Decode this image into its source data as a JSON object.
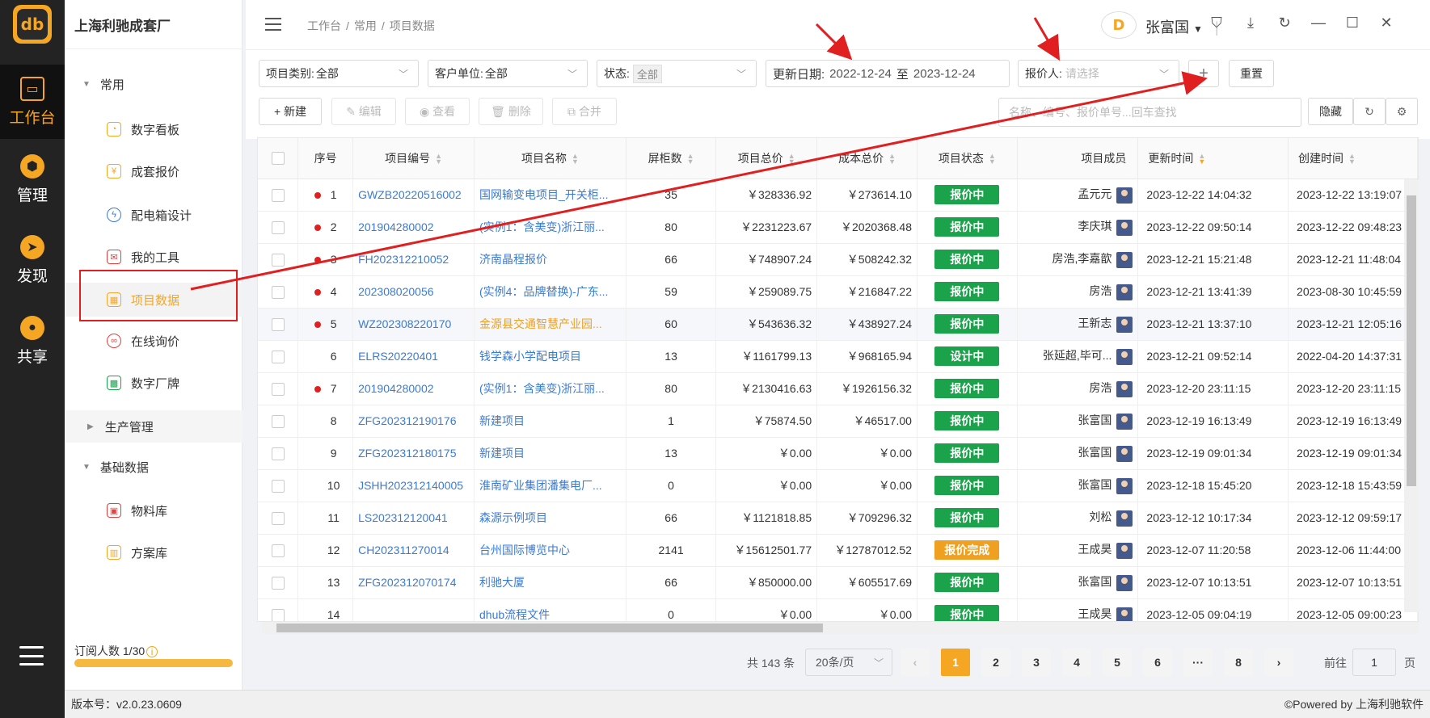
{
  "leftnav": {
    "logo": "db",
    "items": [
      {
        "label": "工作台",
        "icon": "monitor-icon",
        "active": true
      },
      {
        "label": "管理",
        "icon": "hexagon-icon"
      },
      {
        "label": "发现",
        "icon": "compass-icon"
      },
      {
        "label": "共享",
        "icon": "share-icon"
      }
    ]
  },
  "sidebar": {
    "company": "上海利驰成套厂",
    "groups": {
      "common": "常用",
      "production": "生产管理",
      "basic": "基础数据"
    },
    "items": [
      "数字看板",
      "成套报价",
      "配电箱设计",
      "我的工具",
      "项目数据",
      "在线询价",
      "数字厂牌",
      "物料库",
      "方案库"
    ],
    "subscribe": "订阅人数 1/30"
  },
  "header": {
    "breadcrumb": [
      "工作台",
      "/",
      "常用",
      "/",
      "项目数据"
    ],
    "user_logo": "D",
    "username": "张富国"
  },
  "filters": {
    "category_label": "项目类别:",
    "category_value": "全部",
    "customer_label": "客户单位:",
    "customer_value": "全部",
    "status_label": "状态:",
    "status_value": "全部",
    "date_label": "更新日期:",
    "date_from": "2022-12-24",
    "date_sep": "至",
    "date_to": "2023-12-24",
    "quoter_label": "报价人:",
    "quoter_placeholder": "请选择",
    "add": "+",
    "reset": "重置"
  },
  "toolbar": {
    "new": "+ 新建",
    "edit": "✎ 编辑",
    "view": "◉ 查看",
    "delete": "🗑 删除",
    "merge": "⧉ 合并",
    "search_placeholder": "名称、编号、报价单号...回车查找",
    "hide": "隐藏"
  },
  "table": {
    "headers": [
      "序号",
      "项目编号",
      "项目名称",
      "屏柜数",
      "项目总价",
      "成本总价",
      "项目状态",
      "项目成员",
      "更新时间",
      "创建时间"
    ],
    "rows": [
      {
        "no": "1",
        "dot": true,
        "code": "GWZB20220516002",
        "name": "国网输变电项目_开关柜...",
        "cabinets": "35",
        "total": "￥328336.92",
        "cost": "￥273614.10",
        "status": "报价中",
        "member": "孟元元",
        "updated": "2023-12-22 14:04:32",
        "created": "2023-12-22 13:19:07"
      },
      {
        "no": "2",
        "dot": true,
        "code": "201904280002",
        "name": "(实例1：含美变)浙江丽...",
        "cabinets": "80",
        "total": "￥2231223.67",
        "cost": "￥2020368.48",
        "status": "报价中",
        "member": "李庆琪",
        "updated": "2023-12-22 09:50:14",
        "created": "2023-12-22 09:48:23"
      },
      {
        "no": "3",
        "dot": true,
        "code": "FH202312210052",
        "name": "济南晶程报价",
        "cabinets": "66",
        "total": "￥748907.24",
        "cost": "￥508242.32",
        "status": "报价中",
        "member": "房浩,李嘉歆",
        "updated": "2023-12-21 15:21:48",
        "created": "2023-12-21 11:48:04"
      },
      {
        "no": "4",
        "dot": true,
        "code": "202308020056",
        "name": "(实例4：品牌替换)-广东...",
        "cabinets": "59",
        "total": "￥259089.75",
        "cost": "￥216847.22",
        "status": "报价中",
        "member": "房浩",
        "updated": "2023-12-21 13:41:39",
        "created": "2023-08-30 10:45:59"
      },
      {
        "no": "5",
        "dot": true,
        "code": "WZ202308220170",
        "name": "金源县交通智慧产业园...",
        "cabinets": "60",
        "total": "￥543636.32",
        "cost": "￥438927.24",
        "status": "报价中",
        "member": "王新志",
        "updated": "2023-12-21 13:37:10",
        "created": "2023-12-21 12:05:16",
        "highlight": true
      },
      {
        "no": "6",
        "dot": false,
        "code": "ELRS20220401",
        "name": "钱学森小学配电项目",
        "cabinets": "13",
        "total": "￥1161799.13",
        "cost": "￥968165.94",
        "status": "设计中",
        "member": "张延超,毕可...",
        "updated": "2023-12-21 09:52:14",
        "created": "2022-04-20 14:37:31"
      },
      {
        "no": "7",
        "dot": true,
        "code": "201904280002",
        "name": "(实例1：含美变)浙江丽...",
        "cabinets": "80",
        "total": "￥2130416.63",
        "cost": "￥1926156.32",
        "status": "报价中",
        "member": "房浩",
        "updated": "2023-12-20 23:11:15",
        "created": "2023-12-20 23:11:15"
      },
      {
        "no": "8",
        "dot": false,
        "code": "ZFG202312190176",
        "name": "新建项目",
        "cabinets": "1",
        "total": "￥75874.50",
        "cost": "￥46517.00",
        "status": "报价中",
        "member": "张富国",
        "updated": "2023-12-19 16:13:49",
        "created": "2023-12-19 16:13:49"
      },
      {
        "no": "9",
        "dot": false,
        "code": "ZFG202312180175",
        "name": "新建项目",
        "cabinets": "13",
        "total": "￥0.00",
        "cost": "￥0.00",
        "status": "报价中",
        "member": "张富国",
        "updated": "2023-12-19 09:01:34",
        "created": "2023-12-19 09:01:34"
      },
      {
        "no": "10",
        "dot": false,
        "code": "JSHH202312140005",
        "name": "淮南矿业集团潘集电厂...",
        "cabinets": "0",
        "total": "￥0.00",
        "cost": "￥0.00",
        "status": "报价中",
        "member": "张富国",
        "updated": "2023-12-18 15:45:20",
        "created": "2023-12-18 15:43:59"
      },
      {
        "no": "11",
        "dot": false,
        "code": "LS202312120041",
        "name": "森源示例项目",
        "cabinets": "66",
        "total": "￥1121818.85",
        "cost": "￥709296.32",
        "status": "报价中",
        "member": "刘松",
        "updated": "2023-12-12 10:17:34",
        "created": "2023-12-12 09:59:17"
      },
      {
        "no": "12",
        "dot": false,
        "code": "CH202311270014",
        "name": "台州国际博览中心",
        "cabinets": "2141",
        "total": "￥15612501.77",
        "cost": "￥12787012.52",
        "status": "报价完成",
        "member": "王成昊",
        "updated": "2023-12-07 11:20:58",
        "created": "2023-12-06 11:44:00"
      },
      {
        "no": "13",
        "dot": false,
        "code": "ZFG202312070174",
        "name": "利驰大厦",
        "cabinets": "66",
        "total": "￥850000.00",
        "cost": "￥605517.69",
        "status": "报价中",
        "member": "张富国",
        "updated": "2023-12-07 10:13:51",
        "created": "2023-12-07 10:13:51"
      },
      {
        "no": "14",
        "dot": false,
        "code": "",
        "name": "dhub流程文件",
        "cabinets": "0",
        "total": "￥0.00",
        "cost": "￥0.00",
        "status": "报价中",
        "member": "王成昊",
        "updated": "2023-12-05 09:04:19",
        "created": "2023-12-05 09:00:23"
      }
    ]
  },
  "colors": {
    "accent": "#f5a623",
    "status_quoting": "#1aa34a",
    "status_done": "#f0a020",
    "annotation": "#e02020"
  },
  "pager": {
    "total": "共 143 条",
    "page_size": "20条/页",
    "pages": [
      "1",
      "2",
      "3",
      "4",
      "5",
      "6",
      "···",
      "8"
    ],
    "current": "1",
    "goto_label": "前往",
    "goto_value": "1",
    "page_suffix": "页"
  },
  "footer": {
    "version": "版本号：v2.0.23.0609",
    "powered": "©Powered by 上海利驰软件"
  }
}
